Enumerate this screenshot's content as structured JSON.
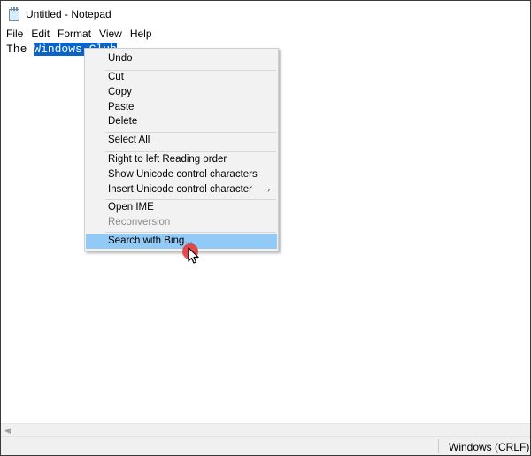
{
  "window": {
    "title": "Untitled - Notepad",
    "icon": "notepad-icon"
  },
  "menubar": {
    "items": [
      "File",
      "Edit",
      "Format",
      "View",
      "Help"
    ]
  },
  "editor": {
    "text_before": "The ",
    "selected_text": "Windows Club"
  },
  "context_menu": {
    "undo": "Undo",
    "cut": "Cut",
    "copy": "Copy",
    "paste": "Paste",
    "delete": "Delete",
    "select_all": "Select All",
    "rtl": "Right to left Reading order",
    "show_unicode": "Show Unicode control characters",
    "insert_unicode": "Insert Unicode control character",
    "open_ime": "Open IME",
    "reconversion": "Reconversion",
    "search_bing": "Search with Bing..."
  },
  "statusbar": {
    "line_ending": "Windows (CRLF)"
  },
  "colors": {
    "selection": "#0a64c8",
    "menu_hover": "#91c9f7",
    "click_indicator": "#e23b3b"
  }
}
